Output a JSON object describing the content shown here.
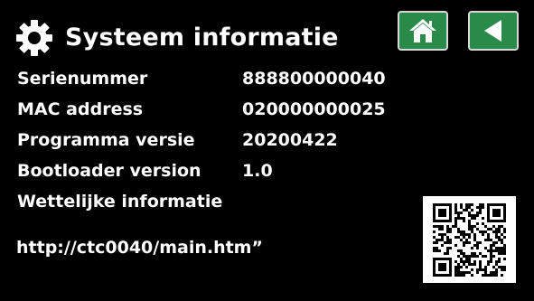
{
  "header": {
    "title": "Systeem informatie",
    "settings_icon": "gear-icon",
    "home_icon": "home-icon",
    "back_icon": "back-arrow-icon"
  },
  "info": {
    "rows": [
      {
        "label": "Serienummer",
        "value": "888800000040"
      },
      {
        "label": "MAC address",
        "value": "020000000025"
      },
      {
        "label": "Programma versie",
        "value": "20200422"
      },
      {
        "label": "Bootloader version",
        "value": "1.0"
      },
      {
        "label": "Wettelijke informatie",
        "value": ""
      }
    ],
    "url": "http://ctc0040/main.htm”"
  },
  "colors": {
    "background": "#000000",
    "text": "#ffffff",
    "button": "#2a8a4a",
    "button_border": "#d8d8d8"
  }
}
